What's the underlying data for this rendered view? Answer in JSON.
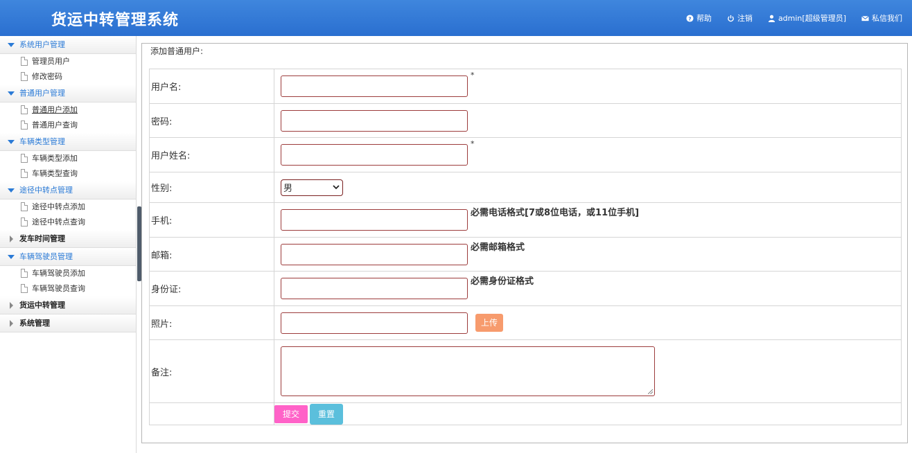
{
  "header": {
    "title": "货运中转管理系统",
    "nav": [
      {
        "icon": "help-icon",
        "label": "帮助"
      },
      {
        "icon": "power-icon",
        "label": "注销"
      },
      {
        "icon": "user-icon",
        "label": "admin[超级管理员]"
      },
      {
        "icon": "mail-icon",
        "label": "私信我们"
      }
    ]
  },
  "sidebar": {
    "groups": [
      {
        "label": "系统用户管理",
        "state": "open",
        "items": [
          "管理员用户",
          "修改密码"
        ]
      },
      {
        "label": "普通用户管理",
        "state": "open",
        "items": [
          "普通用户添加",
          "普通用户查询"
        ],
        "active_item": "普通用户添加"
      },
      {
        "label": "车辆类型管理",
        "state": "open",
        "items": [
          "车辆类型添加",
          "车辆类型查询"
        ]
      },
      {
        "label": "途径中转点管理",
        "state": "open",
        "items": [
          "途径中转点添加",
          "途径中转点查询"
        ]
      },
      {
        "label": "发车时间管理",
        "state": "closed",
        "items": []
      },
      {
        "label": "车辆驾驶员管理",
        "state": "open",
        "items": [
          "车辆驾驶员添加",
          "车辆驾驶员查询"
        ]
      },
      {
        "label": "货运中转管理",
        "state": "closed",
        "items": []
      },
      {
        "label": "系统管理",
        "state": "closed",
        "items": []
      }
    ]
  },
  "form": {
    "legend": "添加普通用户:",
    "username": {
      "label": "用户名:",
      "value": "",
      "required_mark": "*"
    },
    "password": {
      "label": "密码:",
      "value": ""
    },
    "realname": {
      "label": "用户姓名:",
      "value": "",
      "required_mark": "*"
    },
    "gender": {
      "label": "性别:",
      "selected": "男"
    },
    "phone": {
      "label": "手机:",
      "value": "",
      "hint": "必需电话格式[7或8位电话，或11位手机]"
    },
    "email": {
      "label": "邮箱:",
      "value": "",
      "hint": "必需邮箱格式"
    },
    "idcard": {
      "label": "身份证:",
      "value": "",
      "hint": "必需身份证格式"
    },
    "photo": {
      "label": "照片:",
      "value": "",
      "upload_label": "上传"
    },
    "remark": {
      "label": "备注:",
      "value": ""
    },
    "submit_label": "提交",
    "reset_label": "重置"
  },
  "colors": {
    "header": "#2a6fd0",
    "input_border": "#9c3b3b",
    "upload": "#f79b6d",
    "submit": "#ff62c8",
    "reset": "#5bbfdc"
  }
}
